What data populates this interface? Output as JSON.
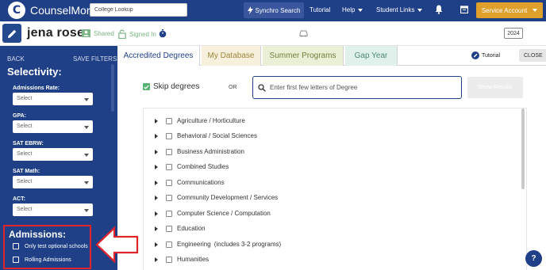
{
  "app": {
    "logo_text": "CounselMore"
  },
  "header": {
    "lookup_placeholder": "College Lookup",
    "synchro_label": "Synchro Search",
    "tutorial_label": "Tutorial",
    "help_label": "Help",
    "student_links_label": "Student Links",
    "service_account_label": "Service Account"
  },
  "profile": {
    "name": "jena rose",
    "shared_label": "Shared",
    "signed_in_label": "Signed In",
    "year": "2024"
  },
  "sidebar": {
    "back_label": "BACK",
    "save_filters_label": "SAVE FILTERS",
    "section_title": "Selectivity:",
    "fields": [
      {
        "label": "Admissions Rate:",
        "value": "Select"
      },
      {
        "label": "GPA:",
        "value": "Select"
      },
      {
        "label": "SAT EBRW:",
        "value": "Select"
      },
      {
        "label": "SAT Math:",
        "value": "Select"
      },
      {
        "label": "ACT:",
        "value": "Select"
      }
    ],
    "admissions": {
      "title": "Admissions:",
      "options": [
        "Only test optional schools",
        "Rolling Admissions"
      ]
    }
  },
  "tabs": {
    "items": [
      "Accredited Degrees",
      "My Database",
      "Summer Programs",
      "Gap Year"
    ],
    "tutorial_label": "Tutorial",
    "close_label": "CLOSE"
  },
  "degrees": {
    "skip_label": "Skip degrees",
    "or_label": "OR",
    "search_placeholder": "Enter first few letters of Degree",
    "show_results_label": "Show Results",
    "items": [
      {
        "label": "Agriculture / Horticulture",
        "note": ""
      },
      {
        "label": "Behavioral / Social Sciences",
        "note": ""
      },
      {
        "label": "Business Administration",
        "note": ""
      },
      {
        "label": "Combined Studies",
        "note": ""
      },
      {
        "label": "Communications",
        "note": ""
      },
      {
        "label": "Community Development / Services",
        "note": ""
      },
      {
        "label": "Computer Science / Computation",
        "note": ""
      },
      {
        "label": "Education",
        "note": ""
      },
      {
        "label": "Engineering",
        "note": "(includes 3-2 programs)"
      },
      {
        "label": "Humanities",
        "note": ""
      }
    ]
  },
  "help_label": "?",
  "colors": {
    "navy": "#1f3f86",
    "accent_orange": "#e0a12c",
    "highlight_red": "#e0242a",
    "success_green": "#55b374"
  }
}
